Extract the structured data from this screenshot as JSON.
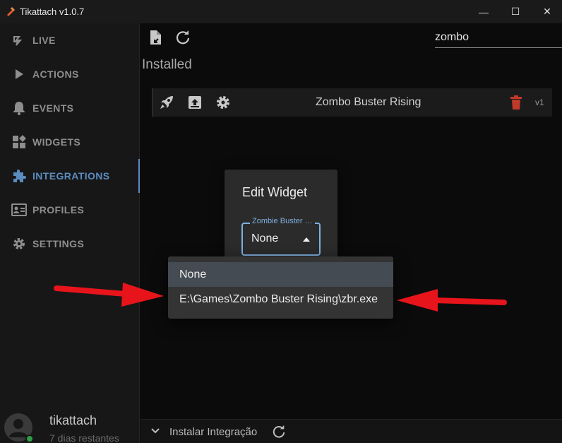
{
  "window": {
    "title": "Tikattach v1.0.7",
    "minimize": "—",
    "maximize": "☐",
    "close": "✕"
  },
  "sidebar": {
    "items": [
      {
        "label": "LIVE",
        "icon": "live-icon"
      },
      {
        "label": "ACTIONS",
        "icon": "play-icon"
      },
      {
        "label": "EVENTS",
        "icon": "bell-icon"
      },
      {
        "label": "WIDGETS",
        "icon": "widgets-icon"
      },
      {
        "label": "INTEGRATIONS",
        "icon": "puzzle-icon",
        "active": true
      },
      {
        "label": "PROFILES",
        "icon": "profile-card-icon"
      },
      {
        "label": "SETTINGS",
        "icon": "gear-icon"
      }
    ],
    "user": {
      "name": "tikattach",
      "subtitle": "7 dias restantes"
    }
  },
  "toolbar": {
    "search_value": "zombo"
  },
  "main": {
    "section_title": "Installed",
    "integration": {
      "title": "Zombo Buster Rising",
      "version": "v1"
    },
    "bottom_bar": {
      "label": "Instalar Integração"
    }
  },
  "dialog": {
    "title": "Edit Widget",
    "select_label": "Zombie Buster Rising",
    "select_value": "None",
    "options": [
      "None",
      "E:\\Games\\Zombo Buster Rising\\zbr.exe"
    ]
  },
  "colors": {
    "accent": "#5b8cc0",
    "select_outline": "#7fb0e0",
    "delete": "#c0392b",
    "arrow": "#e8141b"
  }
}
